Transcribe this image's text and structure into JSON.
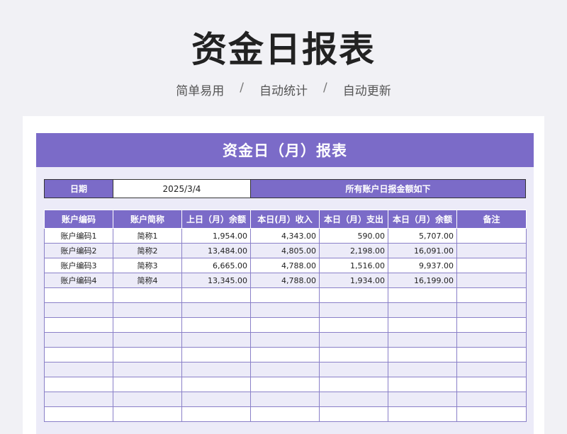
{
  "header": {
    "title": "资金日报表",
    "features": [
      "简单易用",
      "自动统计",
      "自动更新"
    ],
    "separator": "/"
  },
  "sheet": {
    "banner": "资金日（月）报表",
    "date_label": "日期",
    "date_value": "2025/3/4",
    "note": "所有账户日报金额如下",
    "columns": [
      "账户编码",
      "账户简称",
      "上日（月）余额",
      "本日(月）收入",
      "本日（月）支出",
      "本日（月）余额",
      "备注"
    ],
    "rows": [
      [
        "账户编码1",
        "简称1",
        "1,954.00",
        "4,343.00",
        "590.00",
        "5,707.00",
        ""
      ],
      [
        "账户编码2",
        "简称2",
        "13,484.00",
        "4,805.00",
        "2,198.00",
        "16,091.00",
        ""
      ],
      [
        "账户编码3",
        "简称3",
        "6,665.00",
        "4,788.00",
        "1,516.00",
        "9,937.00",
        ""
      ],
      [
        "账户编码4",
        "简称4",
        "13,345.00",
        "4,788.00",
        "1,934.00",
        "16,199.00",
        ""
      ]
    ],
    "empty_rows": 9
  }
}
